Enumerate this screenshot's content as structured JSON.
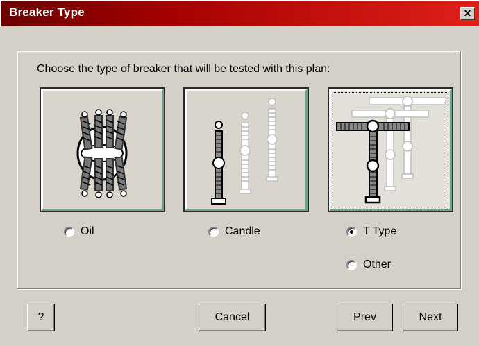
{
  "window": {
    "title": "Breaker Type",
    "close_glyph": "✕"
  },
  "prompt": "Choose the type of breaker that will be tested with this plan:",
  "options": [
    {
      "label": "Oil",
      "icon": "oil-breaker-icon",
      "checked": false
    },
    {
      "label": "Candle",
      "icon": "candle-breaker-icon",
      "checked": false
    },
    {
      "label": "T Type",
      "icon": "t-type-breaker-icon",
      "checked": true
    },
    {
      "label": "Other",
      "checked": false
    }
  ],
  "buttons": {
    "help": "?",
    "cancel": "Cancel",
    "prev": "Prev",
    "next": "Next"
  }
}
